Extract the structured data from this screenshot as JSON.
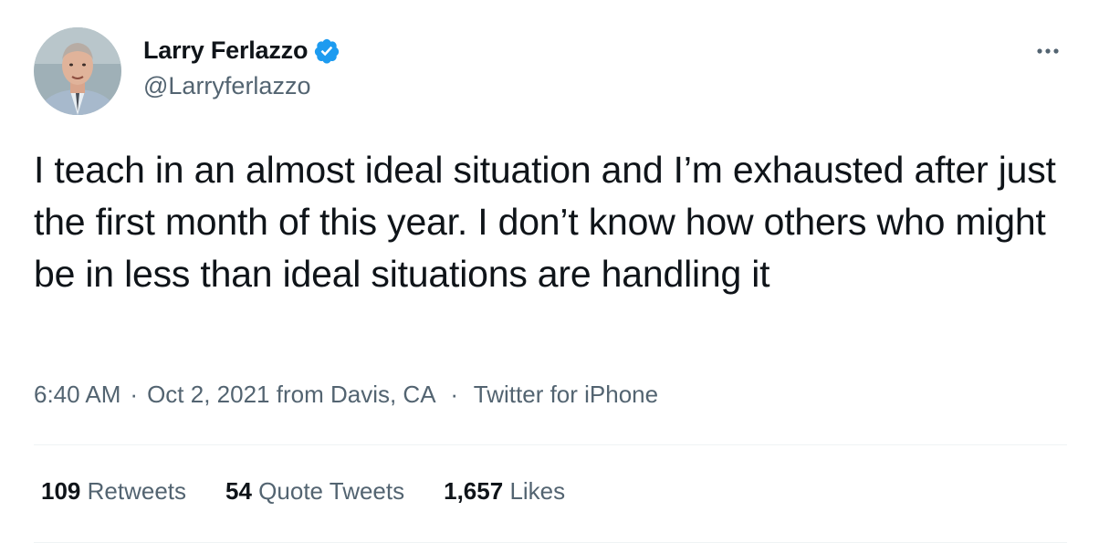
{
  "author": {
    "display_name": "Larry Ferlazzo",
    "handle": "@Larryferlazzo",
    "verified": true,
    "verified_color": "#1d9bf0"
  },
  "tweet": {
    "text": "I teach in an almost ideal situation and I’m exhausted after just the first month of this year. I don’t know how others who might be in less than ideal situations are handling it"
  },
  "meta": {
    "time": "6:40 AM",
    "date": "Oct 2, 2021",
    "location": "from Davis, CA",
    "source": "Twitter for iPhone",
    "separator": "·"
  },
  "stats": [
    {
      "count": "109",
      "label": "Retweets"
    },
    {
      "count": "54",
      "label": "Quote Tweets"
    },
    {
      "count": "1,657",
      "label": "Likes"
    }
  ],
  "icons": {
    "more": "more-horizontal-icon",
    "verified": "verified-badge-icon"
  }
}
